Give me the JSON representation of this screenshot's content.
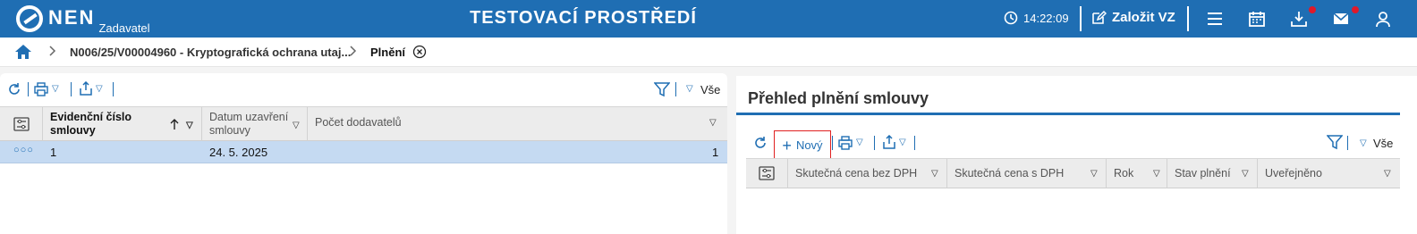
{
  "header": {
    "logo_text": "NEN",
    "logo_sub": "Zadavatel",
    "env_title": "TESTOVACÍ PROSTŘEDÍ",
    "time": "14:22:09",
    "create_label": "Založit VZ"
  },
  "breadcrumb": {
    "items": [
      "N006/25/V00004960 - Kryptografická ochrana utaj...",
      "Plnění"
    ]
  },
  "left_grid": {
    "filter_label": "Vše",
    "columns": [
      "Evidenční číslo smlouvy",
      "Datum uzavření smlouvy",
      "Počet dodavatelů"
    ],
    "rows": [
      {
        "evidencni_cislo": "1",
        "datum": "24. 5. 2025",
        "pocet": "1"
      }
    ]
  },
  "right_panel": {
    "title": "Přehled plnění smlouvy",
    "new_label": "Nový",
    "filter_label": "Vše",
    "columns": [
      "Skutečná cena bez DPH",
      "Skutečná cena s DPH",
      "Rok",
      "Stav plnění",
      "Uveřejněno"
    ]
  },
  "colors": {
    "brand": "#1f6eb3",
    "selected_row": "#c5daf2",
    "alert": "#e0192a"
  }
}
